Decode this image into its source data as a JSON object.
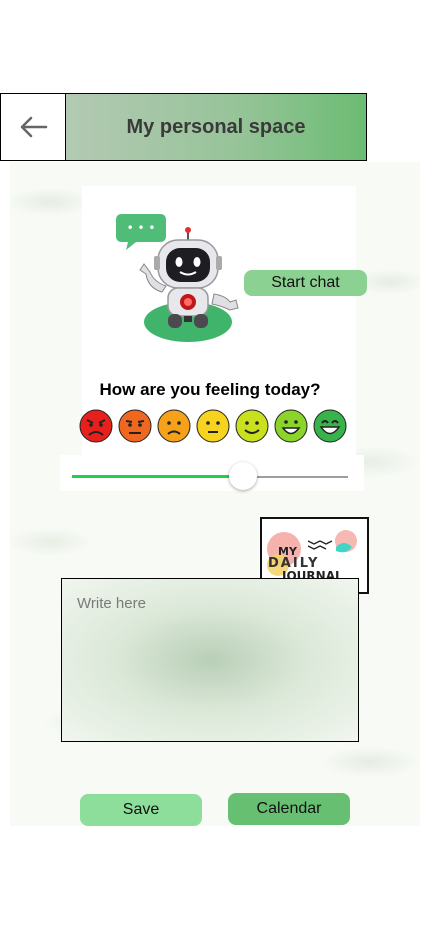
{
  "header": {
    "title": "My personal space",
    "back_icon": "arrow-left-icon"
  },
  "chat": {
    "bubble_text": "• • •",
    "start_label": "Start chat"
  },
  "mood": {
    "question": "How are you feeling today?",
    "emojis": [
      "angry-face-icon",
      "annoyed-face-icon",
      "sad-face-icon",
      "neutral-face-icon",
      "smile-face-icon",
      "happy-face-icon",
      "laughing-face-icon"
    ],
    "colors": [
      "#e8201c",
      "#f06820",
      "#f5a21a",
      "#f5d31e",
      "#c8e01e",
      "#8bd42a",
      "#38b24a"
    ],
    "level": 0.62
  },
  "journal": {
    "logo": {
      "my": "MY",
      "daily": "DAILY",
      "journal": "JOURNAL"
    },
    "placeholder": "Write here"
  },
  "actions": {
    "save_label": "Save",
    "calendar_label": "Calendar"
  },
  "colors": {
    "accent": "#67c072",
    "slider_fill": "#22d04a"
  }
}
